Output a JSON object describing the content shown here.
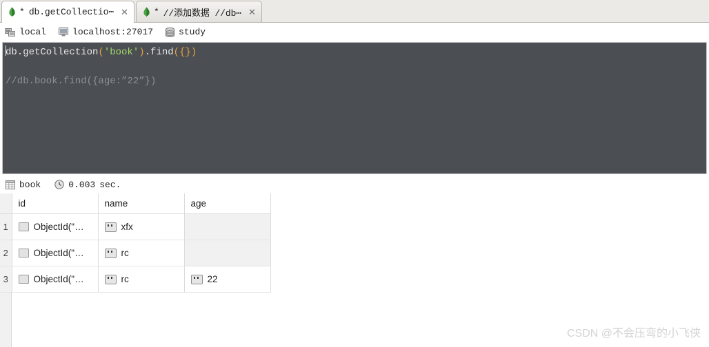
{
  "tabs": [
    {
      "icon": "mongodb-leaf-icon",
      "dirty_marker": "*",
      "label": "db.getCollectio⋯",
      "close_label": "✕",
      "active": true
    },
    {
      "icon": "mongodb-leaf-icon",
      "dirty_marker": "*",
      "label": "//添加数据  //db⋯",
      "close_label": "✕",
      "active": false
    }
  ],
  "connection_bar": {
    "server": {
      "icon": "server-icon",
      "label": "local"
    },
    "host": {
      "icon": "monitor-icon",
      "label": "localhost:27017"
    },
    "database": {
      "icon": "database-icon",
      "label": "study"
    }
  },
  "editor": {
    "background_color": "#4b4e53",
    "lines": [
      {
        "type": "code",
        "text": "db.getCollection('book').find({})",
        "tokens": [
          {
            "t": "db.getCollection",
            "c": "plain"
          },
          {
            "t": "(",
            "c": "paren"
          },
          {
            "t": "'book'",
            "c": "string"
          },
          {
            "t": ")",
            "c": "paren"
          },
          {
            "t": ".find",
            "c": "plain"
          },
          {
            "t": "(",
            "c": "paren"
          },
          {
            "t": "{}",
            "c": "brace"
          },
          {
            "t": ")",
            "c": "paren"
          }
        ]
      },
      {
        "type": "blank",
        "text": ""
      },
      {
        "type": "comment",
        "text": "//db.book.find({age:”22”})",
        "tokens": [
          {
            "t": "//db.book.find({age:”22”})",
            "c": "comment"
          }
        ]
      }
    ]
  },
  "result_bar": {
    "collection": {
      "icon": "grid-icon",
      "label": "book"
    },
    "timing": {
      "icon": "clock-icon",
      "value": "0.003",
      "unit": "sec."
    }
  },
  "result_table": {
    "columns": [
      "id",
      "name",
      "age"
    ],
    "rows": [
      {
        "number": "1",
        "id": {
          "icon": "object-icon",
          "value": "ObjectId(\"…"
        },
        "name": {
          "icon": "string-icon",
          "value": "xfx"
        },
        "age": {
          "icon": null,
          "value": ""
        }
      },
      {
        "number": "2",
        "id": {
          "icon": "object-icon",
          "value": "ObjectId(\"…"
        },
        "name": {
          "icon": "string-icon",
          "value": "rc"
        },
        "age": {
          "icon": null,
          "value": ""
        }
      },
      {
        "number": "3",
        "id": {
          "icon": "object-icon",
          "value": "ObjectId(\"…"
        },
        "name": {
          "icon": "string-icon",
          "value": "rc"
        },
        "age": {
          "icon": "string-icon",
          "value": "22"
        }
      }
    ]
  },
  "watermark": {
    "text": "CSDN @不会压弯的小飞侠"
  }
}
